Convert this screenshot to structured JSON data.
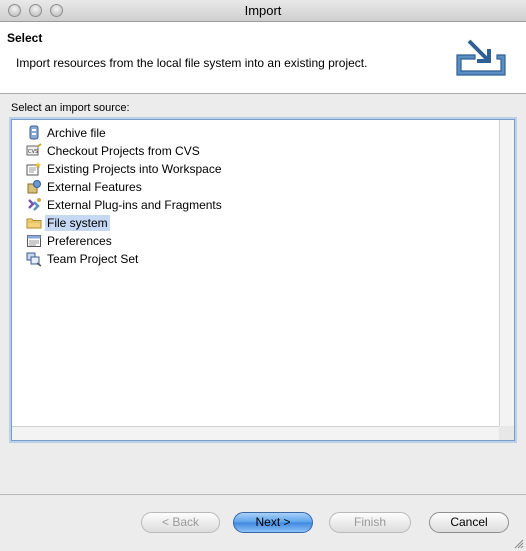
{
  "window": {
    "title": "Import"
  },
  "header": {
    "title": "Select",
    "description": "Import resources from the local file system into an existing project.",
    "icon": "import-tray-icon"
  },
  "source_label": "Select an import source:",
  "list": {
    "items": [
      {
        "label": "Archive file",
        "icon": "archive-icon"
      },
      {
        "label": "Checkout Projects from CVS",
        "icon": "cvs-icon"
      },
      {
        "label": "Existing Projects into Workspace",
        "icon": "projects-icon"
      },
      {
        "label": "External Features",
        "icon": "features-icon"
      },
      {
        "label": "External Plug-ins and Fragments",
        "icon": "plugin-icon"
      },
      {
        "label": "File system",
        "icon": "folder-icon",
        "selected": true
      },
      {
        "label": "Preferences",
        "icon": "preferences-icon"
      },
      {
        "label": "Team Project Set",
        "icon": "team-icon"
      }
    ]
  },
  "buttons": {
    "back": "< Back",
    "next": "Next >",
    "finish": "Finish",
    "cancel": "Cancel"
  },
  "colors": {
    "selection": "#c5d8f4",
    "default_button": "#5aa1ec"
  }
}
